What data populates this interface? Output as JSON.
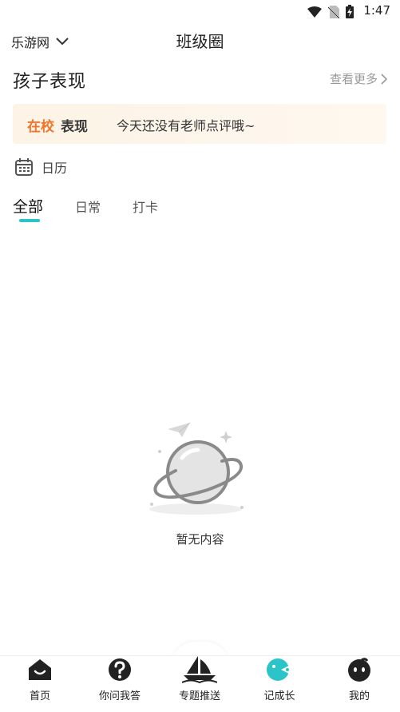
{
  "status_bar": {
    "time": "1:47",
    "icons": [
      "wifi-icon",
      "no-sim-icon",
      "battery-charging-icon"
    ]
  },
  "header": {
    "location": "乐游网",
    "title": "班级圈"
  },
  "section": {
    "title": "孩子表现",
    "see_more": "查看更多"
  },
  "banner": {
    "tag_highlight": "在校",
    "tag_rest": "表现",
    "message": "今天还没有老师点评哦~"
  },
  "calendar": {
    "label": "日历"
  },
  "tabs": [
    {
      "label": "全部",
      "active": true
    },
    {
      "label": "日常",
      "active": false
    },
    {
      "label": "打卡",
      "active": false
    }
  ],
  "empty_state": {
    "text": "暂无内容"
  },
  "bottom_nav": [
    {
      "label": "首页",
      "icon": "home-icon"
    },
    {
      "label": "你问我答",
      "icon": "question-icon"
    },
    {
      "label": "专题推送",
      "icon": "sailboat-icon"
    },
    {
      "label": "记成长",
      "icon": "growth-icon"
    },
    {
      "label": "我的",
      "icon": "profile-icon"
    }
  ],
  "colors": {
    "accent": "#2bc5c9",
    "banner_orange": "#f0752a",
    "muted": "#999999"
  }
}
